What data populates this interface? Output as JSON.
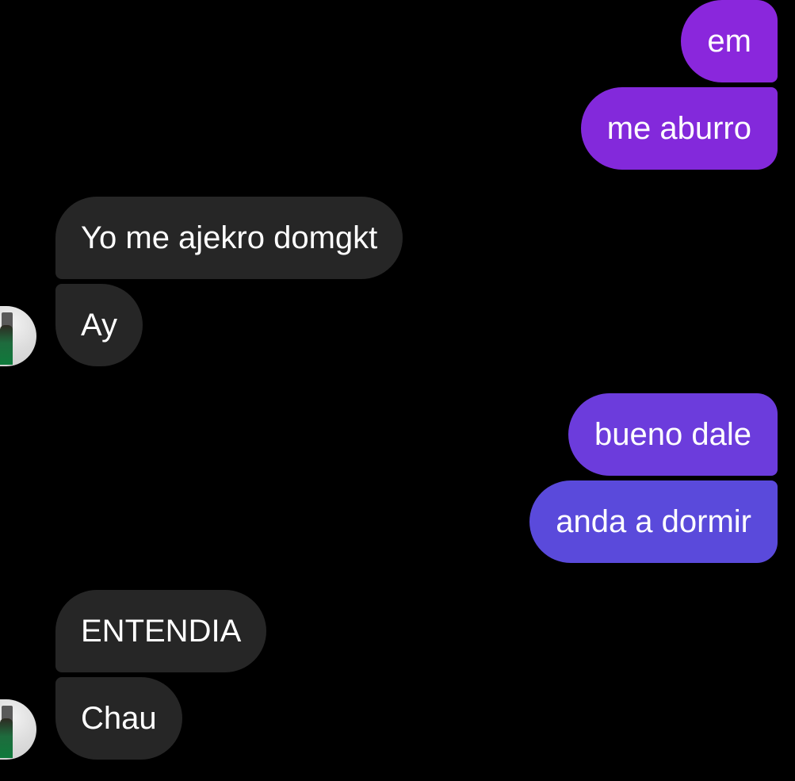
{
  "colors": {
    "background": "#000000",
    "incoming_bubble": "#262626",
    "outgoing_gradient": [
      "#8a2be2",
      "#5d4fdc"
    ]
  },
  "messages": [
    {
      "side": "out",
      "text": "em",
      "color": "#8a27dc"
    },
    {
      "side": "out",
      "text": "me aburro",
      "color": "#8329db"
    },
    {
      "side": "in",
      "text": "Yo me ajekro domgkt"
    },
    {
      "side": "in",
      "text": "Ay"
    },
    {
      "side": "out",
      "text": "bueno dale",
      "color": "#6c3cdc"
    },
    {
      "side": "out",
      "text": "anda a dormir",
      "color": "#5a4adb"
    },
    {
      "side": "in",
      "text": "ENTENDIA"
    },
    {
      "side": "in",
      "text": "Chau"
    }
  ],
  "avatar": {
    "icon": "contact-avatar"
  }
}
